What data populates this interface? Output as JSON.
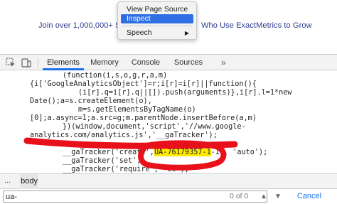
{
  "page": {
    "banner_left": "Join over 1,000,000+ Sm",
    "banner_right": "Who Use ExactMetrics to Grow"
  },
  "context_menu": {
    "items": [
      "View Page Source",
      "Inspect",
      "Speech"
    ],
    "selected": "Inspect",
    "submenu_arrow": "▶"
  },
  "devtools": {
    "tabs": [
      "Elements",
      "Memory",
      "Console",
      "Sources"
    ],
    "active_tab": "Elements",
    "more_tabs": "»"
  },
  "code": {
    "lines": [
      "(function(i,s,o,g,r,a,m)",
      "{i['GoogleAnalyticsObject']=r;i[r]=i[r]||function(){",
      "(i[r].q=i[r].q||[]).push(arguments)},i[r].l=1*new",
      "Date();a=s.createElement(o),",
      "m=s.getElementsByTagName(o)",
      "[0];a.async=1;a.src=g;m.parentNode.insertBefore(a,m)",
      "})(window,document,'script','//www.google-",
      "analytics.com/analytics.js','__gaTracker');",
      "__gaTracker('create', 'UA-76179357-1', 'auto');",
      "__gaTracker('set',",
      "__gaTracker('require', 'ec');"
    ],
    "highlight": "UA-76179357-1"
  },
  "breadcrumb": {
    "dots": "...",
    "current": "body"
  },
  "search": {
    "value": "ua-",
    "count": "0 of 0",
    "up_icon": "▲",
    "down_icon": "▼",
    "cancel_label": "Cancel"
  },
  "colors": {
    "annotation_red": "#e8101a",
    "menu_selected": "#2f6fe4",
    "tab_underline": "#1a73e8",
    "highlight": "#ffeb00"
  }
}
